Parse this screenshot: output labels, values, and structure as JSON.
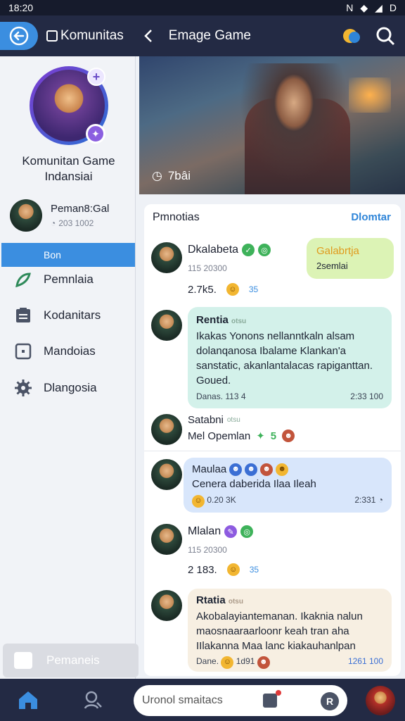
{
  "status": {
    "time": "18:20",
    "battery": "D"
  },
  "header": {
    "app_title": "Komunitas",
    "page_title": "Emage Game"
  },
  "sidebar": {
    "community_name": "Komunitan Game Indansiai",
    "user_name": "Peman8:Gal",
    "user_sub": "203 1002",
    "active_item": "Bon",
    "items": [
      {
        "label": "Pemnlaia",
        "icon": "leaf-icon"
      },
      {
        "label": "Kodanitars",
        "icon": "clipboard-icon"
      },
      {
        "label": "Mandoias",
        "icon": "square-icon"
      },
      {
        "label": "Dlangosia",
        "icon": "gear-icon"
      }
    ],
    "bottom_label": "Pemaneis"
  },
  "banner": {
    "count": "7bâi"
  },
  "feed": {
    "title": "Pmnotias",
    "link": "Dlomtar",
    "messages": [
      {
        "name": "Dkalabeta",
        "sub": "115 20300",
        "stat": "2.7k5.",
        "reactions": "35",
        "bubble": {
          "name": "Galabrtja",
          "text": "2semlai"
        }
      },
      {
        "name": "Rentia",
        "tag": "otsu",
        "text": "Ikakas Yonons nellanntkaln alsam dolanqanosa Ibalame Klankan'a sanstatic, akanlantalacas rapiganttan. Goued.",
        "left": "Danas.",
        "left2": "113 4",
        "time": "2:33 100"
      },
      {
        "name": "Satabni",
        "tag": "otsu",
        "sub": "Mel Opemlan",
        "extra": "5"
      },
      {
        "name": "Maulaa",
        "text": "Cenera daberida Ilaa Ileah",
        "left": "0.20",
        "left2": "3K",
        "time": "2:331"
      },
      {
        "name": "Mlalan",
        "sub": "115 20300",
        "stat": "2 183.",
        "reactions": "35"
      },
      {
        "name": "Rtatia",
        "tag": "otsu",
        "text": "Akobalayiantemanan. Ikaknia nalun maosnaaraarloonr keah tran aha IIlakanna Maa lanc kiakauhanlpan",
        "left": "Dane.",
        "left2": "1d91",
        "time": "1261 100"
      }
    ]
  },
  "bottom": {
    "search_placeholder": "Uronol smaitacs"
  }
}
